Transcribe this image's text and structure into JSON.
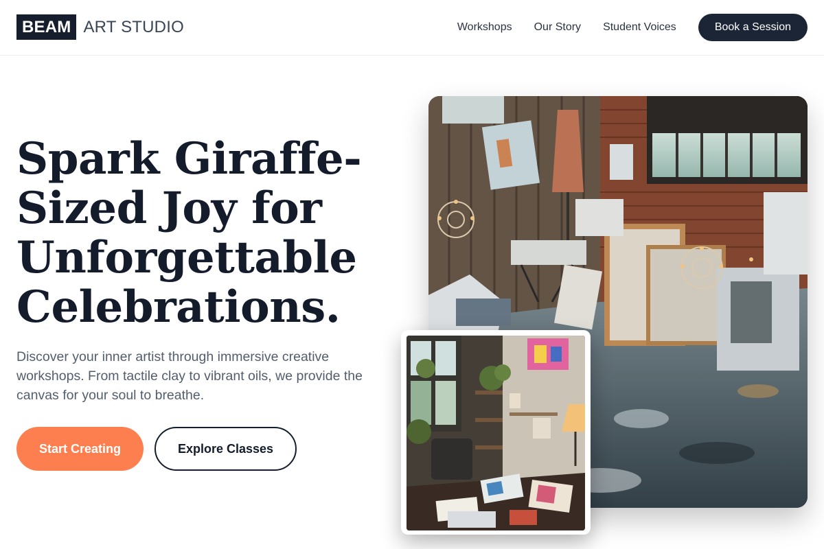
{
  "brand": {
    "mark": "BEAM",
    "name": "ART STUDIO"
  },
  "nav": {
    "links": [
      "Workshops",
      "Our Story",
      "Student Voices"
    ],
    "cta": "Book a Session"
  },
  "hero": {
    "title": "Spark Giraffe-Sized Joy for Unforgettable Celebrations.",
    "description": "Discover your inner artist through immersive creative workshops. From tactile clay to vibrant oils, we provide the canvas for your soul to breathe.",
    "primary_button": "Start Creating",
    "secondary_button": "Explore Classes"
  },
  "colors": {
    "brand_dark": "#161e2e",
    "accent_orange": "#fd7f4f",
    "body_text": "#535d6d"
  }
}
